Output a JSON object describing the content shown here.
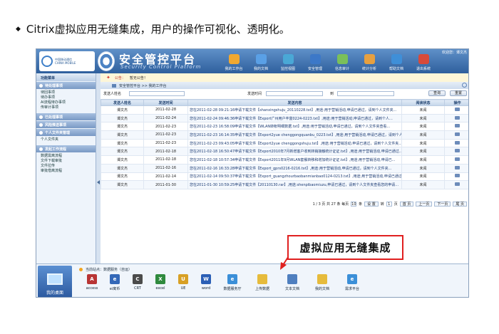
{
  "slide": {
    "bullet": "◆",
    "heading": "Citrix虚拟应用无缝集成，用户的操作可视化、透明化。"
  },
  "header": {
    "logo_cn": "中国移动通信",
    "logo_en": "CHINA MOBILE",
    "title": "安全管控平台",
    "subtitle": "Security Control Platform",
    "welcome": "欢迎您：谭文杰",
    "nav": [
      {
        "label": "我的工作台",
        "icon": "desk-icon",
        "color": "#f0a830"
      },
      {
        "label": "我的文档",
        "icon": "document-icon",
        "color": "#5aa0e6"
      },
      {
        "label": "监控视图",
        "icon": "monitor-icon",
        "color": "#4aa8d6"
      },
      {
        "label": "安全管理",
        "icon": "shield-icon",
        "color": "#3c78c8"
      },
      {
        "label": "信息审计",
        "icon": "audit-icon",
        "color": "#7ac05a"
      },
      {
        "label": "统计分析",
        "icon": "chart-icon",
        "color": "#e6a040"
      },
      {
        "label": "帮助文档",
        "icon": "help-icon",
        "color": "#3f8fd8"
      },
      {
        "label": "退出系统",
        "icon": "exit-icon",
        "color": "#d84a3a"
      }
    ]
  },
  "left_panel": {
    "title": "功能菜单",
    "sections": [
      {
        "label": "待处理事项",
        "items": [
          "待回事项",
          "待办事项",
          "AI流程待办事项",
          "传审计事项"
        ]
      },
      {
        "label": "已处理事项",
        "items": []
      },
      {
        "label": "风险推送事项",
        "items": []
      },
      {
        "label": "个人文件夹管理",
        "items": [
          "个人文件夹"
        ]
      },
      {
        "label": "发起工作流程",
        "items": [
          "数据需离流程",
          "文件下载审批",
          "文件拉传",
          "审批借离流程"
        ]
      }
    ]
  },
  "main": {
    "notice_label": "公告：",
    "notice_text": "暂无公告！",
    "breadcrumb": "安全管控平台 >> 我的工作台",
    "search": {
      "sender_label": "发送人姓名",
      "time_label": "发送时间",
      "to_label": "到",
      "query_button": "查询",
      "reset_button": "重置"
    },
    "table": {
      "headers": [
        "发送人姓名",
        "发送时间",
        "发送内容",
        "阅读状态",
        "操作"
      ],
      "rows": [
        [
          "谭文杰",
          "2011-02-28",
          "您在2011-02-28 09:21:16申请下载文件【shanxingshuju_20110228.txt】,用途:用于营销活动,申请已通过，请到个人文件夹...",
          "未阅"
        ],
        [
          "谭文杰",
          "2011-02-24",
          "您在2011-02-24 09:46:36申请下载文件【Export广州用户丰富0224-0223.txt】,用途:用于营销活动,申请已通过，请到个人...",
          "未阅"
        ],
        [
          "谭文杰",
          "2011-02-23",
          "您在2011-02-23 16:58:09申请下载文件【WLAN转帐明细数据.txt】,用途:用于营销活动,申请已通过，请到个人文件夹查看...",
          "未阅"
        ],
        [
          "谭文杰",
          "2011-02-23",
          "您在2011-02-23 16:14:35申请下载文件【Export2yue chenggongquanbu_0223.txt】,用途:用于营销活动,申请已通过，请到个人...",
          "未阅"
        ],
        [
          "谭文杰",
          "2011-02-23",
          "您在2011-02-23 09:43:05申请下载文件【Export2yue chenggongshuju.txt】,用途:用于营销活动,申请已通过，请到个人文件夹...",
          "未阅"
        ],
        [
          "谭文杰",
          "2011-02-18",
          "您在2011-02-18 16:50:47申请下载文件【Export2010年7月新增客户收到转销接触统计证证.txt】,用途:用于营销活动,申请已通过...",
          "未阅"
        ],
        [
          "谭文杰",
          "2011-02-18",
          "您在2011-02-18 10:57:34申请下载文件【Export2011年9月WLAN套餐转移和增加统计证证.txt】,用途:用于营销活动,申请已...",
          "未阅"
        ],
        [
          "谭文杰",
          "2011-02-16",
          "您在2011-02-16 16:33:28申请下载文件【Export_gprs0216-0216.txt】,用途:用于营销活动,申请已通过，请到个人文件夹...",
          "未阅"
        ],
        [
          "谭文杰",
          "2011-02-14",
          "您在2011-02-14 09:50:37申请下载文件【Export_guangzhourbaobanmianbao0124-0213.txt】,用途:用于营销活动,申请已通过...",
          "未阅"
        ],
        [
          "谭文杰",
          "2011-01-30",
          "您在2011-01-30 10:59:25申请下载文件【20110130.rar】,用途:shenpibaomiuzu,申请已通过，请到个人文件夹查看您的申请...",
          "未阅"
        ]
      ]
    },
    "pager": {
      "summary": "1 / 3 页  共 27 条  每页",
      "page_size": "10",
      "unit": "条",
      "go_button": "设 置",
      "jump_label": "转",
      "page_input": "1",
      "page_unit": "页",
      "first": "首 页",
      "prev": "上一页",
      "next": "下一页",
      "last": "尾 页"
    }
  },
  "dock": {
    "tile_label": "我的桌面",
    "header": "当前站点：数据服务（自运）",
    "apps": [
      {
        "label": "access",
        "icon": "access-icon",
        "color": "#b83434",
        "glyph": "A"
      },
      {
        "label": "ei离币",
        "icon": "ei-icon",
        "color": "#3468b8",
        "glyph": "e"
      },
      {
        "label": "CRT",
        "icon": "crt-icon",
        "color": "#4b4b4b",
        "glyph": "C"
      },
      {
        "label": "excel",
        "icon": "excel-icon",
        "color": "#2f8a3e",
        "glyph": "X"
      },
      {
        "label": "UE",
        "icon": "ue-icon",
        "color": "#d8a025",
        "glyph": "U"
      },
      {
        "label": "word",
        "icon": "word-icon",
        "color": "#2b5fb6",
        "glyph": "W"
      },
      {
        "label": "数据服务厅",
        "icon": "ie-icon",
        "color": "#3b8fd8",
        "glyph": "e"
      },
      {
        "label": "上传数据",
        "icon": "folder-icon",
        "color": "#e6bb3c",
        "glyph": ""
      },
      {
        "label": "文本文档",
        "icon": "text-doc-icon",
        "color": "#4f7fbf",
        "glyph": ""
      },
      {
        "label": "我的文档",
        "icon": "my-doc-icon",
        "color": "#e6bb3c",
        "glyph": ""
      },
      {
        "label": "需求平台",
        "icon": "ie-icon",
        "color": "#3b8fd8",
        "glyph": "e"
      }
    ]
  },
  "callout": {
    "text": "虚拟应用无缝集成",
    "color": "#e02020"
  }
}
